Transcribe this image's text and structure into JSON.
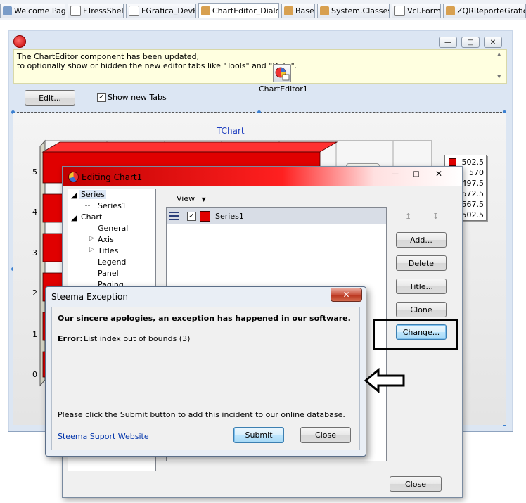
{
  "tabs": [
    {
      "label": "Welcome Page"
    },
    {
      "label": "FTressShell"
    },
    {
      "label": "FGrafica_DevEx"
    },
    {
      "label": "ChartEditor_Dialog"
    },
    {
      "label": "Base"
    },
    {
      "label": "System.Classes"
    },
    {
      "label": "Vcl.Forms"
    },
    {
      "label": "ZQRReporteGrafica"
    }
  ],
  "main": {
    "info_line1": "The ChartEditor component has been updated,",
    "info_line2": "to optionally show or hidden the new editor tabs like \"Tools\" and \"Data\".",
    "component_label": "ChartEditor1",
    "edit_button": "Edit...",
    "show_tabs_label": "Show new Tabs",
    "show_tabs_checked": true
  },
  "chart": {
    "title": "TChart",
    "y_ticks": [
      "5",
      "4",
      "3",
      "2",
      "1",
      "0"
    ],
    "legend_values": [
      "502.5",
      "570",
      "497.5",
      "572.5",
      "567.5",
      "502.5"
    ]
  },
  "edit_dialog": {
    "title": "Editing Chart1",
    "tree": {
      "series": "Series",
      "series1": "Series1",
      "chart": "Chart",
      "general": "General",
      "axis": "Axis",
      "titles": "Titles",
      "legend": "Legend",
      "panel": "Panel",
      "paging": "Paging"
    },
    "view_label": "View",
    "series_item": "Series1",
    "add_button": "Add...",
    "delete_button": "Delete",
    "title_button": "Title...",
    "clone_button": "Clone",
    "change_button": "Change...",
    "close_button": "Close"
  },
  "exception_dialog": {
    "title": "Steema Exception",
    "heading": "Our sincere apologies, an exception has happened in our software.",
    "error_label": "Error:",
    "error_text": "List index out of bounds (3)",
    "instruction": "Please click the Submit button to add this incident to our online database.",
    "link": "Steema Suport Website",
    "submit_button": "Submit",
    "close_button": "Close"
  },
  "colors": {
    "series_red": "#e00000",
    "info_yellow": "#ffffe0",
    "title_bar_red": "#d00000"
  }
}
